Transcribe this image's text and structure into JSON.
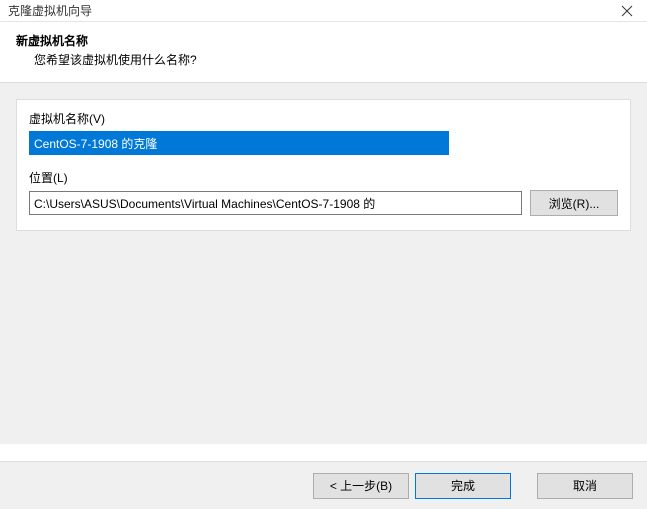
{
  "titlebar": {
    "title": "克隆虚拟机向导"
  },
  "header": {
    "title": "新虚拟机名称",
    "subtitle": "您希望该虚拟机使用什么名称?"
  },
  "fields": {
    "name": {
      "label": "虚拟机名称(V)",
      "value": "CentOS-7-1908 的克隆"
    },
    "location": {
      "label": "位置(L)",
      "value": "C:\\Users\\ASUS\\Documents\\Virtual Machines\\CentOS-7-1908 的",
      "browse_label": "浏览(R)..."
    }
  },
  "footer": {
    "back_label": "< 上一步(B)",
    "finish_label": "完成",
    "cancel_label": "取消"
  }
}
